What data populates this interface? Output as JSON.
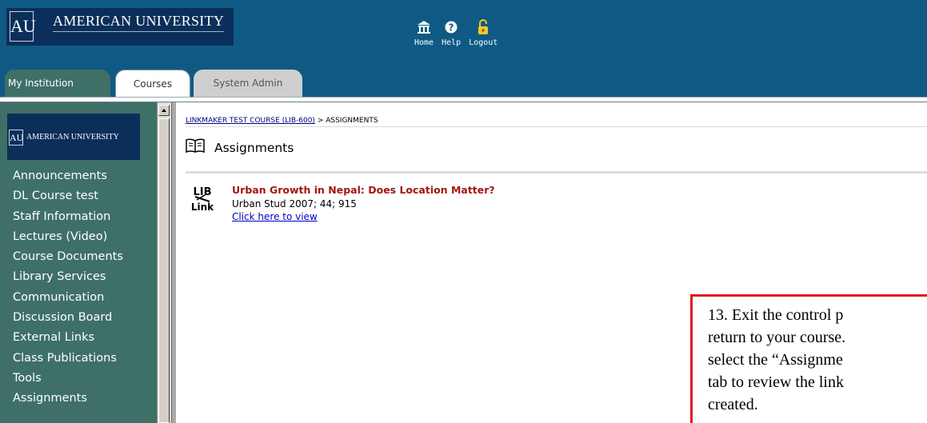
{
  "header": {
    "logo_mark": "AU",
    "logo_text": "AMERICAN UNIVERSITY",
    "nav": [
      {
        "label": "Home",
        "icon": "home-icon"
      },
      {
        "label": "Help",
        "icon": "help-icon"
      },
      {
        "label": "Logout",
        "icon": "lock-icon"
      }
    ]
  },
  "tabs": [
    {
      "label": "My Institution",
      "state": "inactive"
    },
    {
      "label": "Courses",
      "state": "active"
    },
    {
      "label": "System Admin",
      "state": "inactive"
    }
  ],
  "sidebar": {
    "logo_mark": "AU",
    "logo_text": "AMERICAN UNIVERSITY",
    "items": [
      {
        "label": "Announcements"
      },
      {
        "label": "DL Course test"
      },
      {
        "label": "Staff Information"
      },
      {
        "label": "Lectures (Video)"
      },
      {
        "label": "Course Documents"
      },
      {
        "label": "Library Services"
      },
      {
        "label": "Communication"
      },
      {
        "label": "Discussion Board"
      },
      {
        "label": "External Links"
      },
      {
        "label": "Class Publications"
      },
      {
        "label": "Tools"
      },
      {
        "label": "Assignments"
      }
    ]
  },
  "breadcrumb": {
    "course_link": "LINKMAKER TEST COURSE (LIB-600)",
    "separator": " > ",
    "current": "ASSIGNMENTS"
  },
  "page": {
    "title": "Assignments",
    "title_icon": "book-icon"
  },
  "assignment": {
    "icon_label_top": "LIB",
    "icon_label_bottom": "Link",
    "title": "Urban Growth in Nepal: Does Location Matter?",
    "citation": "Urban Stud 2007; 44; 915",
    "link_text": "Click here to view"
  },
  "callout": {
    "lines": [
      "13. Exit the control p",
      "return to your course.",
      "select the “Assignme",
      "tab to review the link",
      "created."
    ]
  },
  "colors": {
    "header_blue": "#0f5a85",
    "sidebar_green": "#3e7068",
    "logo_navy": "#0b2f5a",
    "title_red": "#a31515",
    "callout_border": "#e0191e"
  }
}
